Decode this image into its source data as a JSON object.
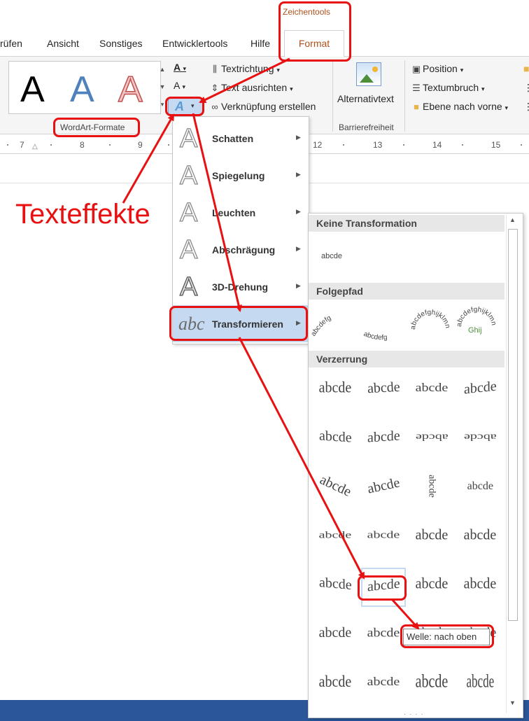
{
  "ribbon": {
    "tabs": [
      "rüfen",
      "Ansicht",
      "Sonstiges",
      "Entwicklertools",
      "Hilfe"
    ],
    "context_label": "Zeichentools",
    "format_tab": "Format",
    "gallery_letter": "A",
    "wordart_group_label": "WordArt-Formate",
    "text_buttons": {
      "text_direction": "Textrichtung",
      "align_text": "Text ausrichten",
      "create_link": "Verknüpfung erstellen"
    },
    "alt_text": "Alternativtext",
    "accessibility_label": "Barrierefreiheit",
    "arrange": {
      "position": "Position",
      "wrap_text": "Textumbruch",
      "bring_forward": "Ebene nach vorne"
    },
    "text_effects_icon": "A"
  },
  "ruler": {
    "numbers": [
      "7",
      "8",
      "9",
      "12",
      "13",
      "14",
      "15"
    ]
  },
  "menu": {
    "items": [
      "Schatten",
      "Spiegelung",
      "Leuchten",
      "Abschrägung",
      "3D-Drehung",
      "Transformieren"
    ],
    "transform_icon_text": "abc"
  },
  "submenu": {
    "headers": [
      "Keine Transformation",
      "Folgepfad",
      "Verzerrung"
    ],
    "sample": "abcde",
    "path_samples": [
      "abcdefg",
      "abcdefg",
      "abcdefghijklmno",
      "abcdefghijklmno",
      "Ghij"
    ],
    "tooltip": "Welle: nach oben"
  },
  "annotation": {
    "label": "Texteffekte"
  }
}
